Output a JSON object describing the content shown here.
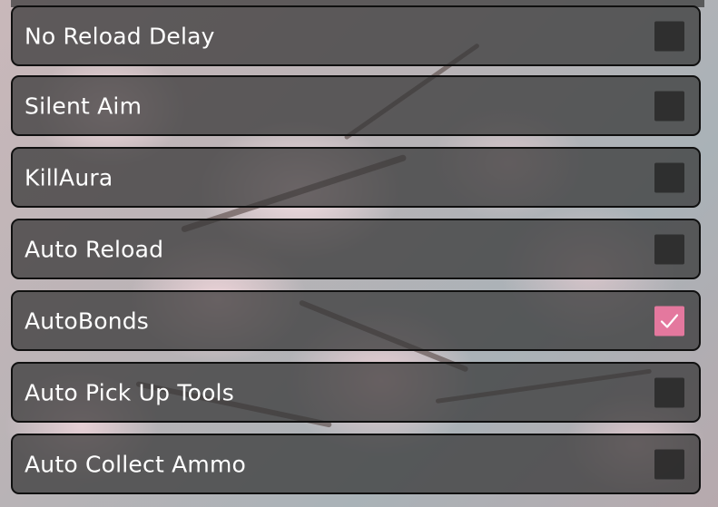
{
  "colors": {
    "row_background": "#343434",
    "row_border": "#101010",
    "checkbox_unchecked": "#282828",
    "checkbox_checked": "#e4789e",
    "label_text": "#ffffff"
  },
  "toggles": [
    {
      "label": "No Reload Delay",
      "checked": false
    },
    {
      "label": "Silent Aim",
      "checked": false
    },
    {
      "label": "KillAura",
      "checked": false
    },
    {
      "label": "Auto Reload",
      "checked": false
    },
    {
      "label": "AutoBonds",
      "checked": true
    },
    {
      "label": "Auto Pick Up Tools",
      "checked": false
    },
    {
      "label": "Auto Collect Ammo",
      "checked": false
    }
  ],
  "icons": {
    "checkmark": "checkmark-icon"
  }
}
